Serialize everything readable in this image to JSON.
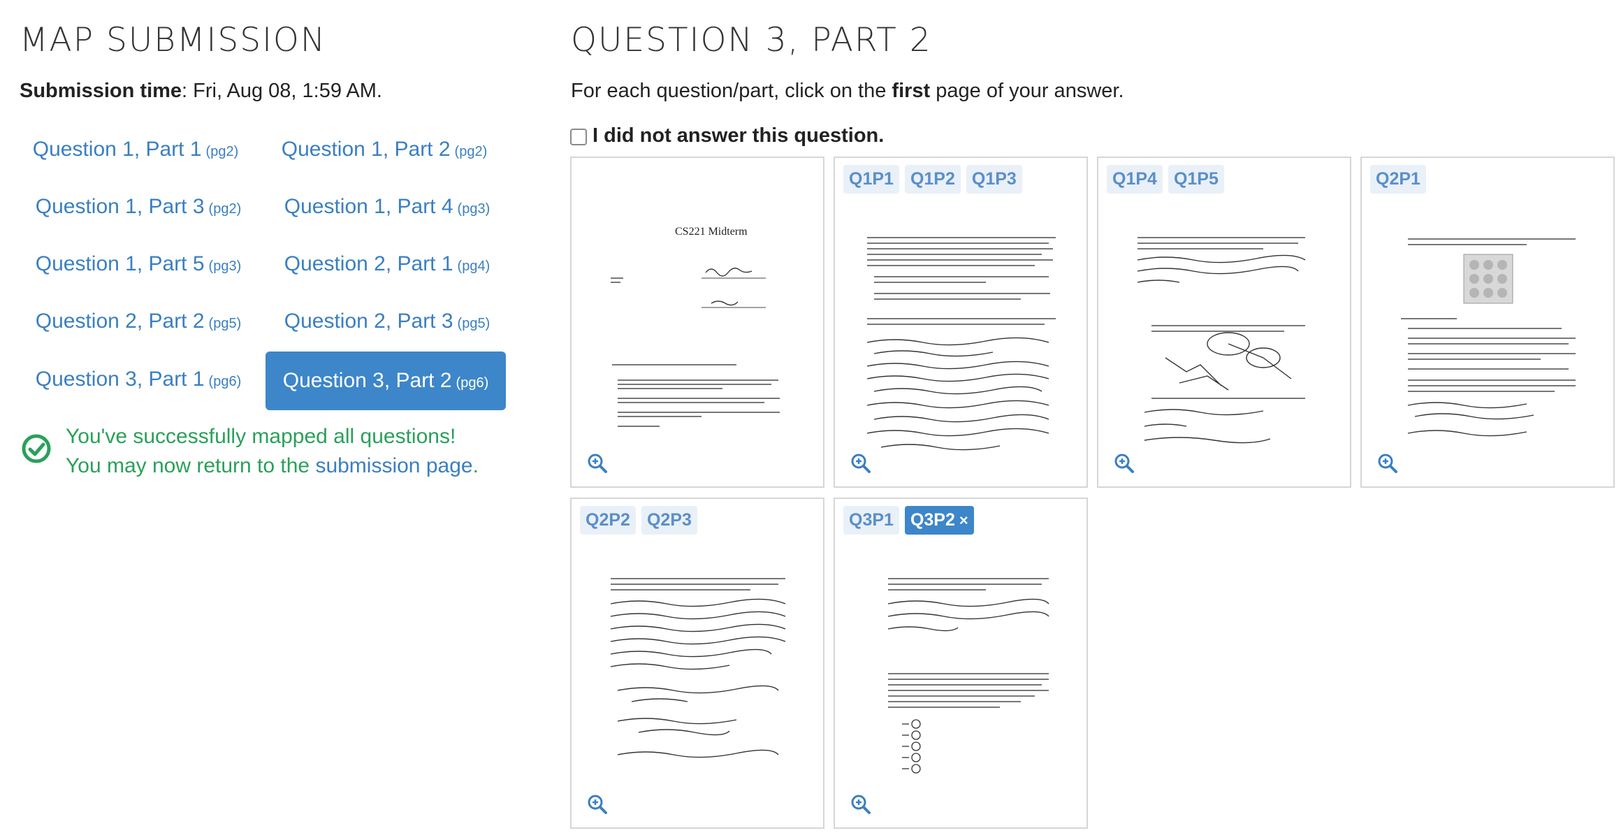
{
  "left": {
    "title": "MAP SUBMISSION",
    "submission_label": "Submission time",
    "submission_value": ": Fri, Aug 08, 1:59 AM.",
    "questions": [
      {
        "label": "Question 1, Part 1",
        "pg": "(pg2)"
      },
      {
        "label": "Question 1, Part 2",
        "pg": "(pg2)"
      },
      {
        "label": "Question 1, Part 3",
        "pg": "(pg2)"
      },
      {
        "label": "Question 1, Part 4",
        "pg": "(pg3)"
      },
      {
        "label": "Question 1, Part 5",
        "pg": "(pg3)"
      },
      {
        "label": "Question 2, Part 1",
        "pg": "(pg4)"
      },
      {
        "label": "Question 2, Part 2",
        "pg": "(pg5)"
      },
      {
        "label": "Question 2, Part 3",
        "pg": "(pg5)"
      },
      {
        "label": "Question 3, Part 1",
        "pg": "(pg6)"
      },
      {
        "label": "Question 3, Part 2",
        "pg": "(pg6)"
      }
    ],
    "active_index": 9,
    "success_line1": "You've successfully mapped all questions!",
    "success_line2_prefix": "You may now return to the ",
    "success_link": "submission page",
    "success_line2_suffix": "."
  },
  "right": {
    "title": "QUESTION 3, PART 2",
    "instruction_prefix": "For each question/part, click on the ",
    "instruction_bold": "first",
    "instruction_suffix": " page of your answer.",
    "no_answer_label": "I did not answer this question.",
    "pages": [
      {
        "tags": [],
        "doc_title": "CS221 Midterm"
      },
      {
        "tags": [
          "Q1P1",
          "Q1P2",
          "Q1P3"
        ]
      },
      {
        "tags": [
          "Q1P4",
          "Q1P5"
        ]
      },
      {
        "tags": [
          "Q2P1"
        ]
      },
      {
        "tags": [
          "Q2P2",
          "Q2P3"
        ]
      },
      {
        "tags": [
          "Q3P1",
          "Q3P2"
        ],
        "selected_tag": "Q3P2",
        "remove_icon": "×"
      }
    ]
  },
  "colors": {
    "accent": "#3d86c9",
    "link": "#3a7fc1",
    "success": "#2aa05a"
  }
}
